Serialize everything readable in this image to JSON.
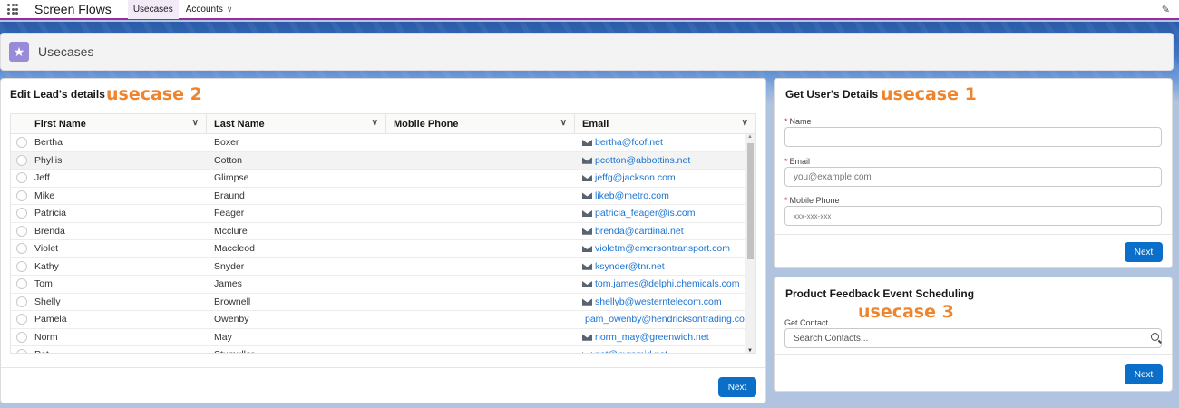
{
  "topnav": {
    "app_name": "Screen Flows",
    "tabs": [
      {
        "label": "Usecases",
        "active": true
      },
      {
        "label": "Accounts",
        "active": false
      }
    ]
  },
  "page": {
    "title": "Usecases",
    "icon": "star-icon"
  },
  "lead_card": {
    "title": "Edit Lead's details",
    "usecase_label": "usecase 2",
    "columns": [
      "First Name",
      "Last Name",
      "Mobile Phone",
      "Email"
    ],
    "rows": [
      {
        "first": "Bertha",
        "last": "Boxer",
        "phone": "",
        "email": "bertha@fcof.net"
      },
      {
        "first": "Phyllis",
        "last": "Cotton",
        "phone": "",
        "email": "pcotton@abbottins.net"
      },
      {
        "first": "Jeff",
        "last": "Glimpse",
        "phone": "",
        "email": "jeffg@jackson.com"
      },
      {
        "first": "Mike",
        "last": "Braund",
        "phone": "",
        "email": "likeb@metro.com"
      },
      {
        "first": "Patricia",
        "last": "Feager",
        "phone": "",
        "email": "patricia_feager@is.com"
      },
      {
        "first": "Brenda",
        "last": "Mcclure",
        "phone": "",
        "email": "brenda@cardinal.net"
      },
      {
        "first": "Violet",
        "last": "Maccleod",
        "phone": "",
        "email": "violetm@emersontransport.com"
      },
      {
        "first": "Kathy",
        "last": "Snyder",
        "phone": "",
        "email": "ksynder@tnr.net"
      },
      {
        "first": "Tom",
        "last": "James",
        "phone": "",
        "email": "tom.james@delphi.chemicals.com"
      },
      {
        "first": "Shelly",
        "last": "Brownell",
        "phone": "",
        "email": "shellyb@westerntelecom.com"
      },
      {
        "first": "Pamela",
        "last": "Owenby",
        "phone": "",
        "email": "pam_owenby@hendricksontrading.com"
      },
      {
        "first": "Norm",
        "last": "May",
        "phone": "",
        "email": "norm_may@greenwich.net"
      },
      {
        "first": "Pat",
        "last": "Stumuller",
        "phone": "",
        "email": "pat@pyramid.net"
      }
    ],
    "next_label": "Next"
  },
  "user_card": {
    "title": "Get User's Details",
    "usecase_label": "usecase 1",
    "name_label": "Name",
    "name_value": "",
    "email_label": "Email",
    "email_placeholder": "you@example.com",
    "phone_label": "Mobile Phone",
    "phone_placeholder": "xxx-xxx-xxx",
    "required_mark": "*",
    "next_label": "Next"
  },
  "feedback_card": {
    "title": "Product Feedback Event Scheduling",
    "usecase_label": "usecase 3",
    "contact_label": "Get Contact",
    "contact_placeholder": "Search Contacts...",
    "next_label": "Next"
  }
}
